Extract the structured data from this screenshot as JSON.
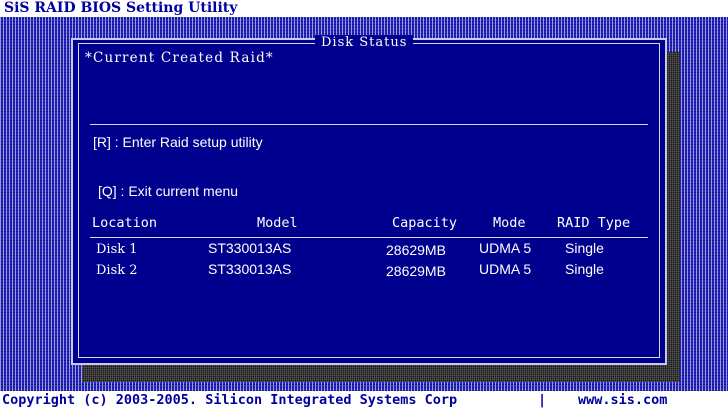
{
  "app": {
    "title": "SiS RAID BIOS Setting Utility"
  },
  "dialog": {
    "title": "Disk Status",
    "section_label": "*Current Created Raid*",
    "hints": [
      "[R] : Enter Raid setup utility",
      "[Q] : Exit current menu"
    ]
  },
  "table": {
    "headers": [
      "Location",
      "Model",
      "Capacity",
      "Mode",
      "RAID Type"
    ],
    "rows": [
      [
        "Disk 1",
        "ST330013AS",
        "28629MB",
        "UDMA 5",
        "Single"
      ],
      [
        "Disk 2",
        "ST330013AS",
        "28629MB",
        "UDMA 5",
        "Single"
      ]
    ]
  },
  "footer": {
    "copyright": "Copyright (c) 2003-2005. Silicon Integrated Systems Corp",
    "separator": "|",
    "website": "www.sis.com"
  },
  "colors": {
    "dialog_background": "#00008e",
    "desktop_pattern": "#2424c8",
    "accent_text": "#00009e"
  }
}
